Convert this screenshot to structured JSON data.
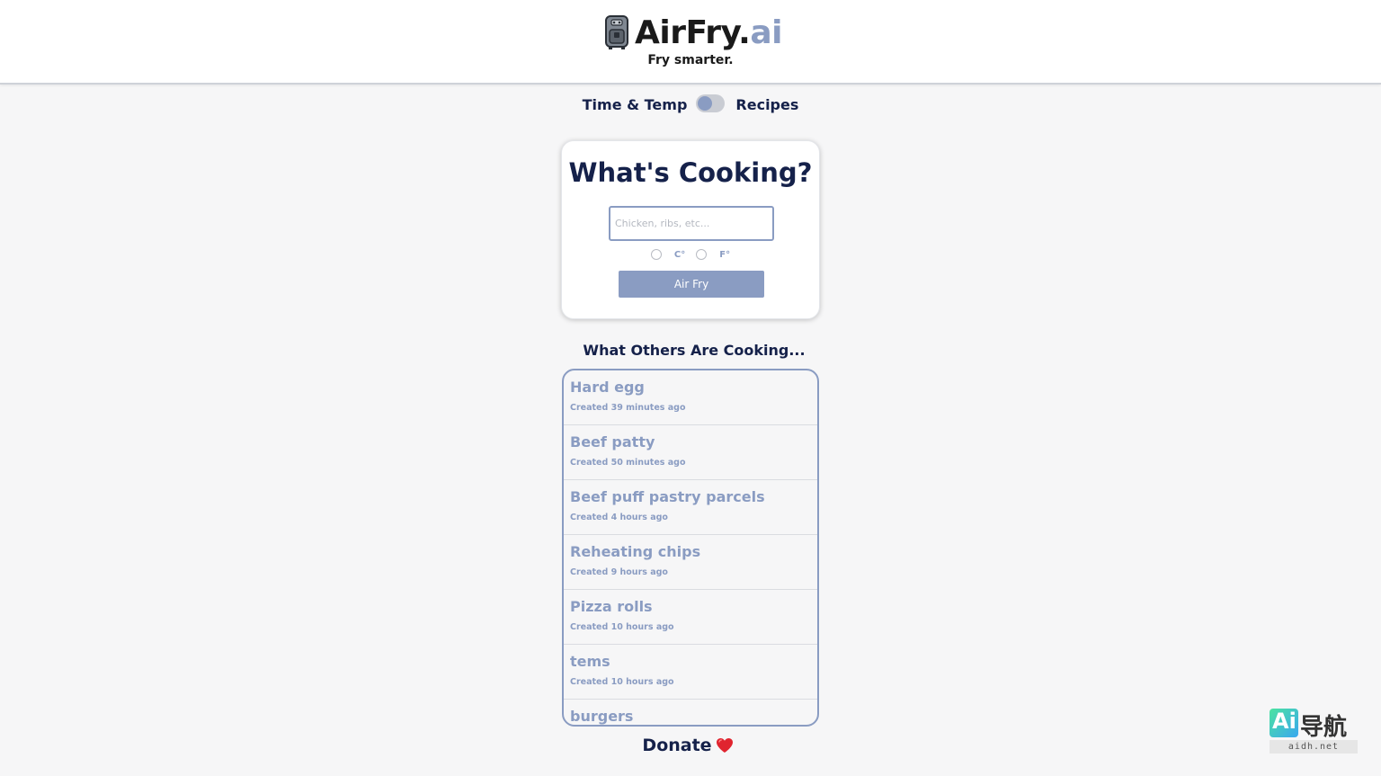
{
  "brand": {
    "name_main": "AirFry.",
    "name_accent": "ai",
    "tagline": "Fry smarter."
  },
  "mode_switch": {
    "left_label": "Time & Temp",
    "right_label": "Recipes"
  },
  "search_card": {
    "title": "What's Cooking?",
    "input_value": "",
    "input_placeholder": "Chicken, ribs, etc...",
    "unit_celsius": "C°",
    "unit_fahrenheit": "F°",
    "button_label": "Air Fry"
  },
  "recent": {
    "heading": "What Others Are Cooking...",
    "items": [
      {
        "title": "Hard egg",
        "created": "Created 39 minutes ago"
      },
      {
        "title": "Beef patty",
        "created": "Created 50 minutes ago"
      },
      {
        "title": "Beef puff pastry parcels",
        "created": "Created 4 hours ago"
      },
      {
        "title": "Reheating chips",
        "created": "Created 9 hours ago"
      },
      {
        "title": "Pizza rolls",
        "created": "Created 10 hours ago"
      },
      {
        "title": "tems",
        "created": "Created 10 hours ago"
      },
      {
        "title": "burgers",
        "created": ""
      }
    ]
  },
  "footer": {
    "donate_label": "Donate"
  },
  "watermark": {
    "logo_text": "Ai",
    "cn_text": "导航",
    "url_text": "aidh.net"
  },
  "colors": {
    "navy": "#15214a",
    "accent": "#8a9cc2",
    "background": "#f6f6f7",
    "heart": "#e0242f"
  },
  "icons": [
    "air-fryer-icon",
    "heart-icon"
  ]
}
